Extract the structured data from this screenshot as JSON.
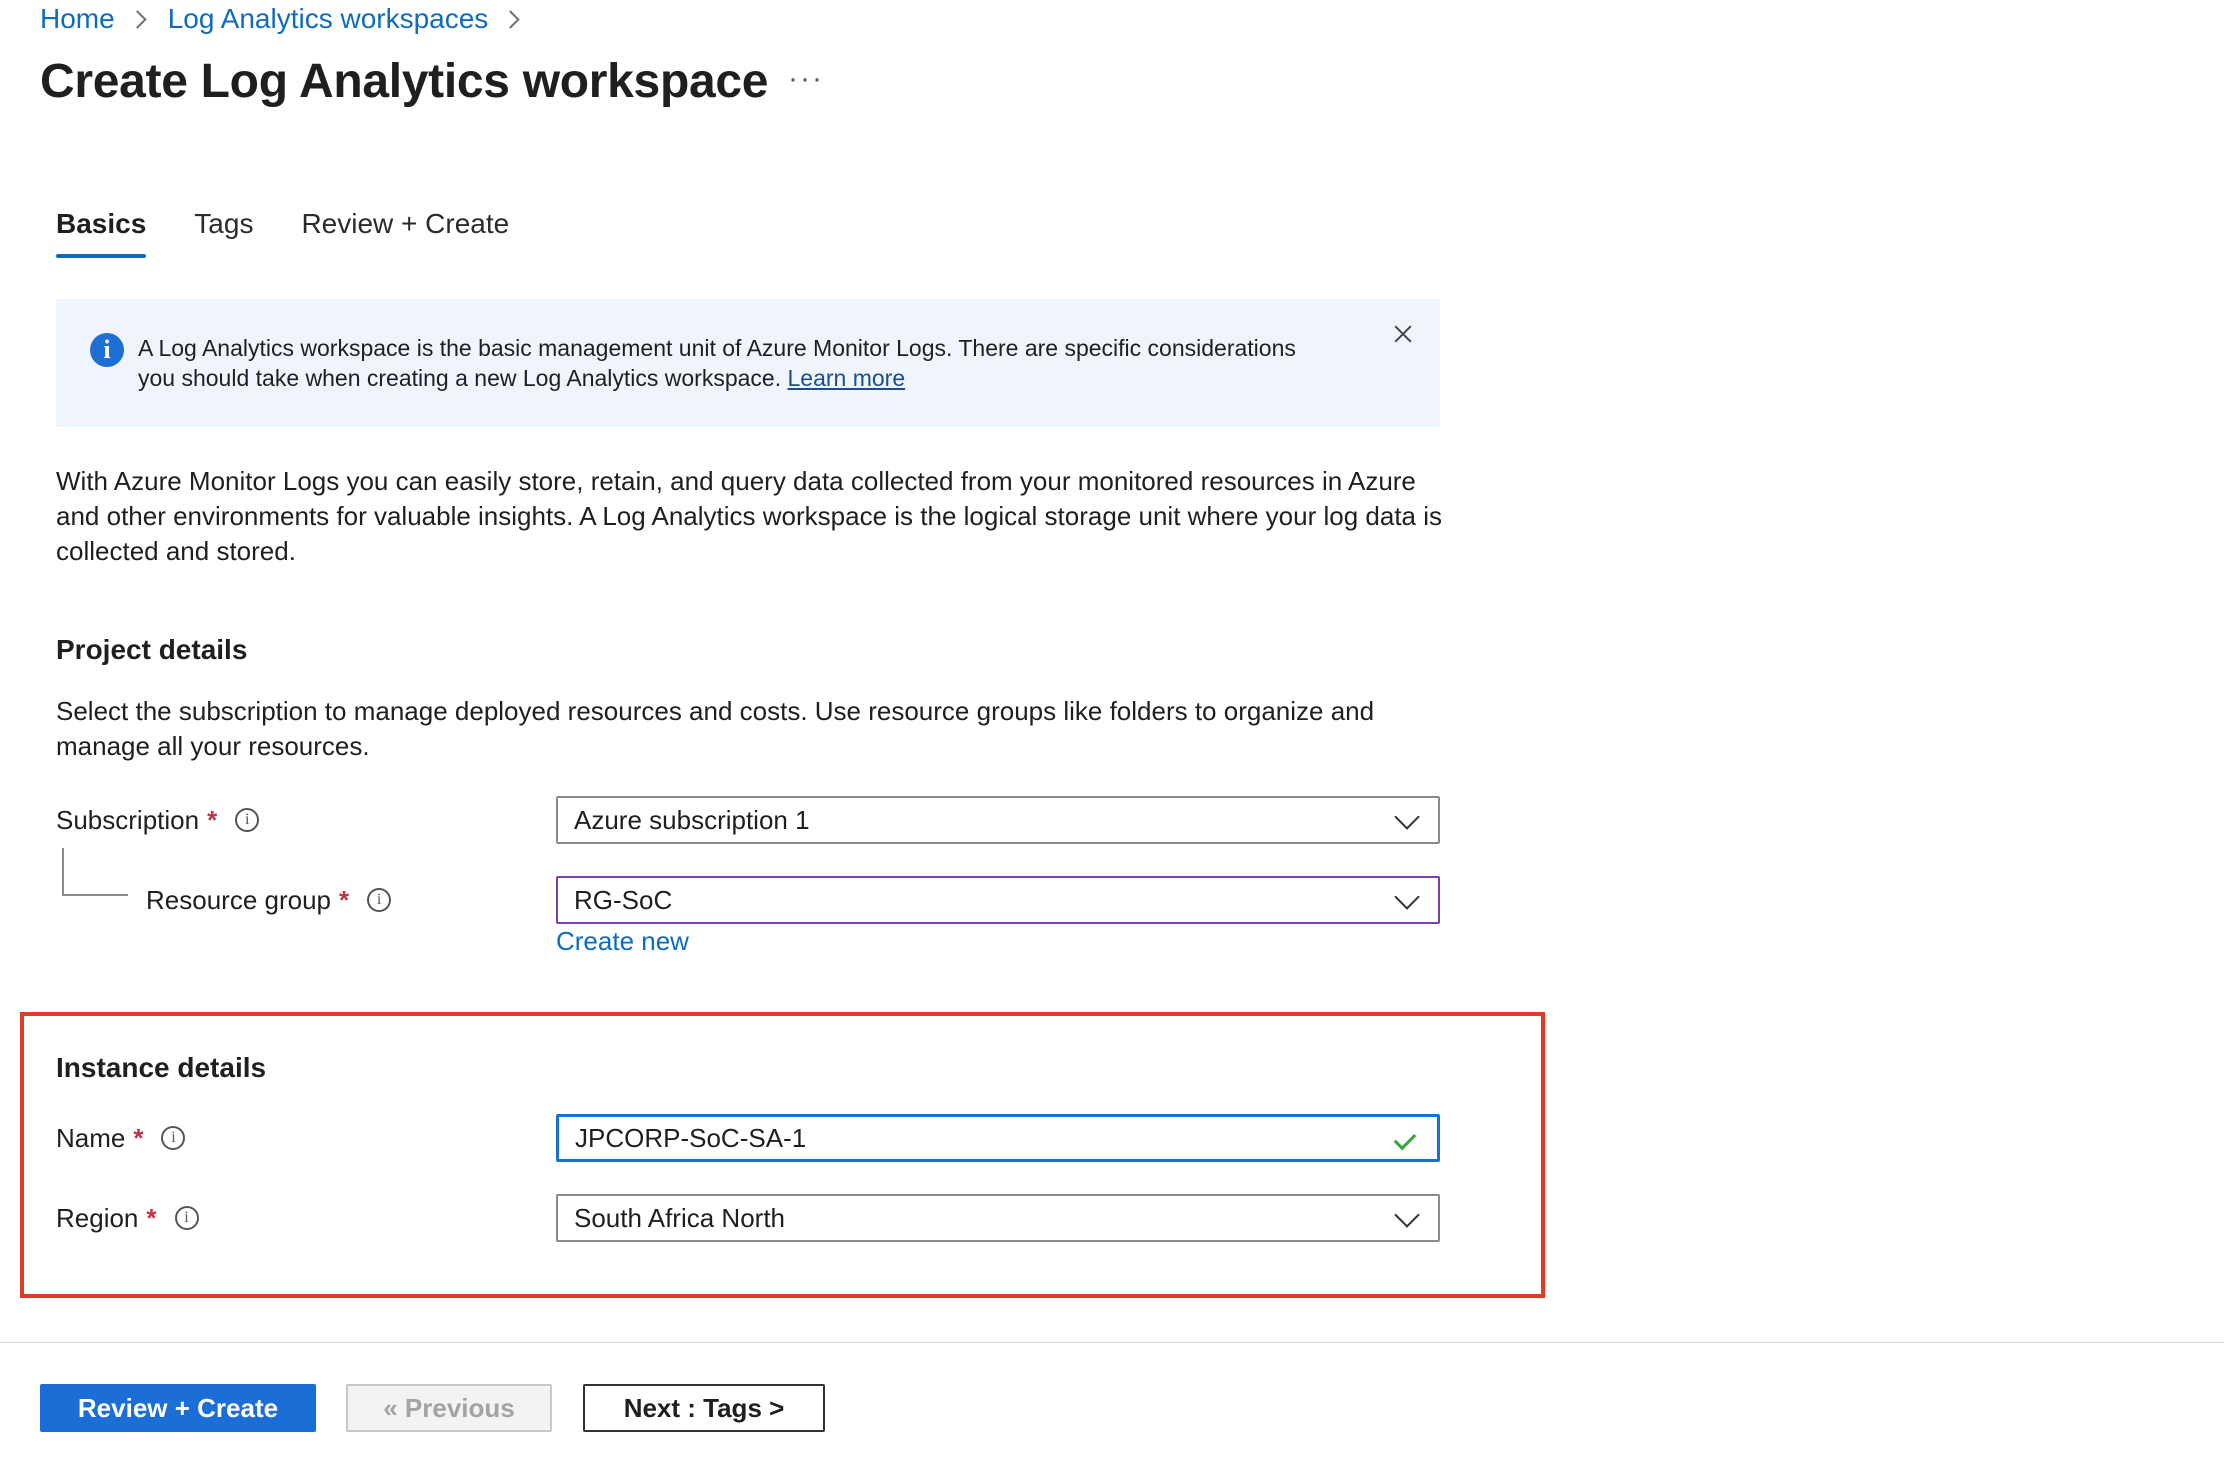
{
  "breadcrumb": [
    {
      "label": "Home"
    },
    {
      "label": "Log Analytics workspaces"
    }
  ],
  "page": {
    "title": "Create Log Analytics workspace",
    "more_label": "···"
  },
  "tabs": [
    {
      "label": "Basics",
      "active": true
    },
    {
      "label": "Tags",
      "active": false
    },
    {
      "label": "Review + Create",
      "active": false
    }
  ],
  "info_banner": {
    "text": "A Log Analytics workspace is the basic management unit of Azure Monitor Logs. There are specific considerations you should take when creating a new Log Analytics workspace.",
    "link": "Learn more",
    "icon": "info-icon",
    "close_icon": "close-icon"
  },
  "description": "With Azure Monitor Logs you can easily store, retain, and query data collected from your monitored resources in Azure and other environments for valuable insights. A Log Analytics workspace is the logical storage unit where your log data is collected and stored.",
  "project_details": {
    "heading": "Project details",
    "description": "Select the subscription to manage deployed resources and costs. Use resource groups like folders to organize and manage all your resources.",
    "subscription": {
      "label": "Subscription",
      "required_mark": "*",
      "value": "Azure subscription 1"
    },
    "resource_group": {
      "label": "Resource group",
      "required_mark": "*",
      "value": "RG-SoC",
      "create_new": "Create new"
    }
  },
  "instance_details": {
    "heading": "Instance details",
    "name": {
      "label": "Name",
      "required_mark": "*",
      "value": "JPCORP-SoC-SA-1"
    },
    "region": {
      "label": "Region",
      "required_mark": "*",
      "value": "South Africa North"
    }
  },
  "footer": {
    "review_create": "Review + Create",
    "previous": "« Previous",
    "next": "Next : Tags >"
  },
  "colors": {
    "accent": "#0f6cbd",
    "primary_button": "#1b6ed6",
    "highlight_border": "#e23a2a",
    "info_background": "#eff4fd",
    "valid_check": "#3aa33a"
  }
}
